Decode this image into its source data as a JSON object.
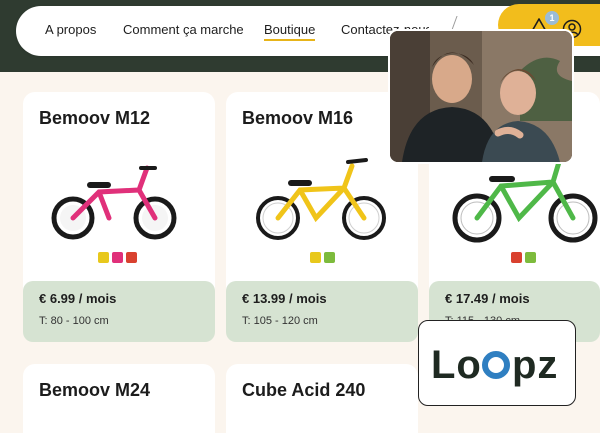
{
  "nav": {
    "links": [
      "A propos",
      "Comment ça marche",
      "Boutique",
      "Contactez-nous"
    ],
    "active": "Boutique",
    "badge_count": "1"
  },
  "products": [
    {
      "name": "Bemoov M12",
      "price": "€ 6.99 / mois",
      "size": "T: 80 - 100 cm",
      "frame_color": "#e0307a",
      "swatches": [
        "#e8c81c",
        "#e0307a",
        "#d9412f"
      ]
    },
    {
      "name": "Bemoov M16",
      "price": "€ 13.99 / mois",
      "size": "T: 105 - 120 cm",
      "frame_color": "#f0c419",
      "swatches": [
        "#e8c81c",
        "#7dbb3c"
      ]
    },
    {
      "name": "",
      "price": "€ 17.49 / mois",
      "size": "T: 115 - 130 cm",
      "frame_color": "#4fb848",
      "swatches": [
        "#d9412f",
        "#7dbb3c"
      ]
    },
    {
      "name": "Bemoov M24",
      "price": "",
      "size": "",
      "frame_color": "",
      "swatches": []
    },
    {
      "name": "Cube Acid 240",
      "price": "",
      "size": "",
      "frame_color": "",
      "swatches": []
    }
  ],
  "overlay": {
    "logo_text": "Loopz",
    "logo_color": "#1f2a22",
    "accent_color": "#2f7fc1"
  },
  "colors": {
    "header_band": "#2f3b30",
    "accent_yellow": "#f2bd1c",
    "price_bg": "#d6e3d2",
    "page_bg": "#fbf5ee"
  }
}
